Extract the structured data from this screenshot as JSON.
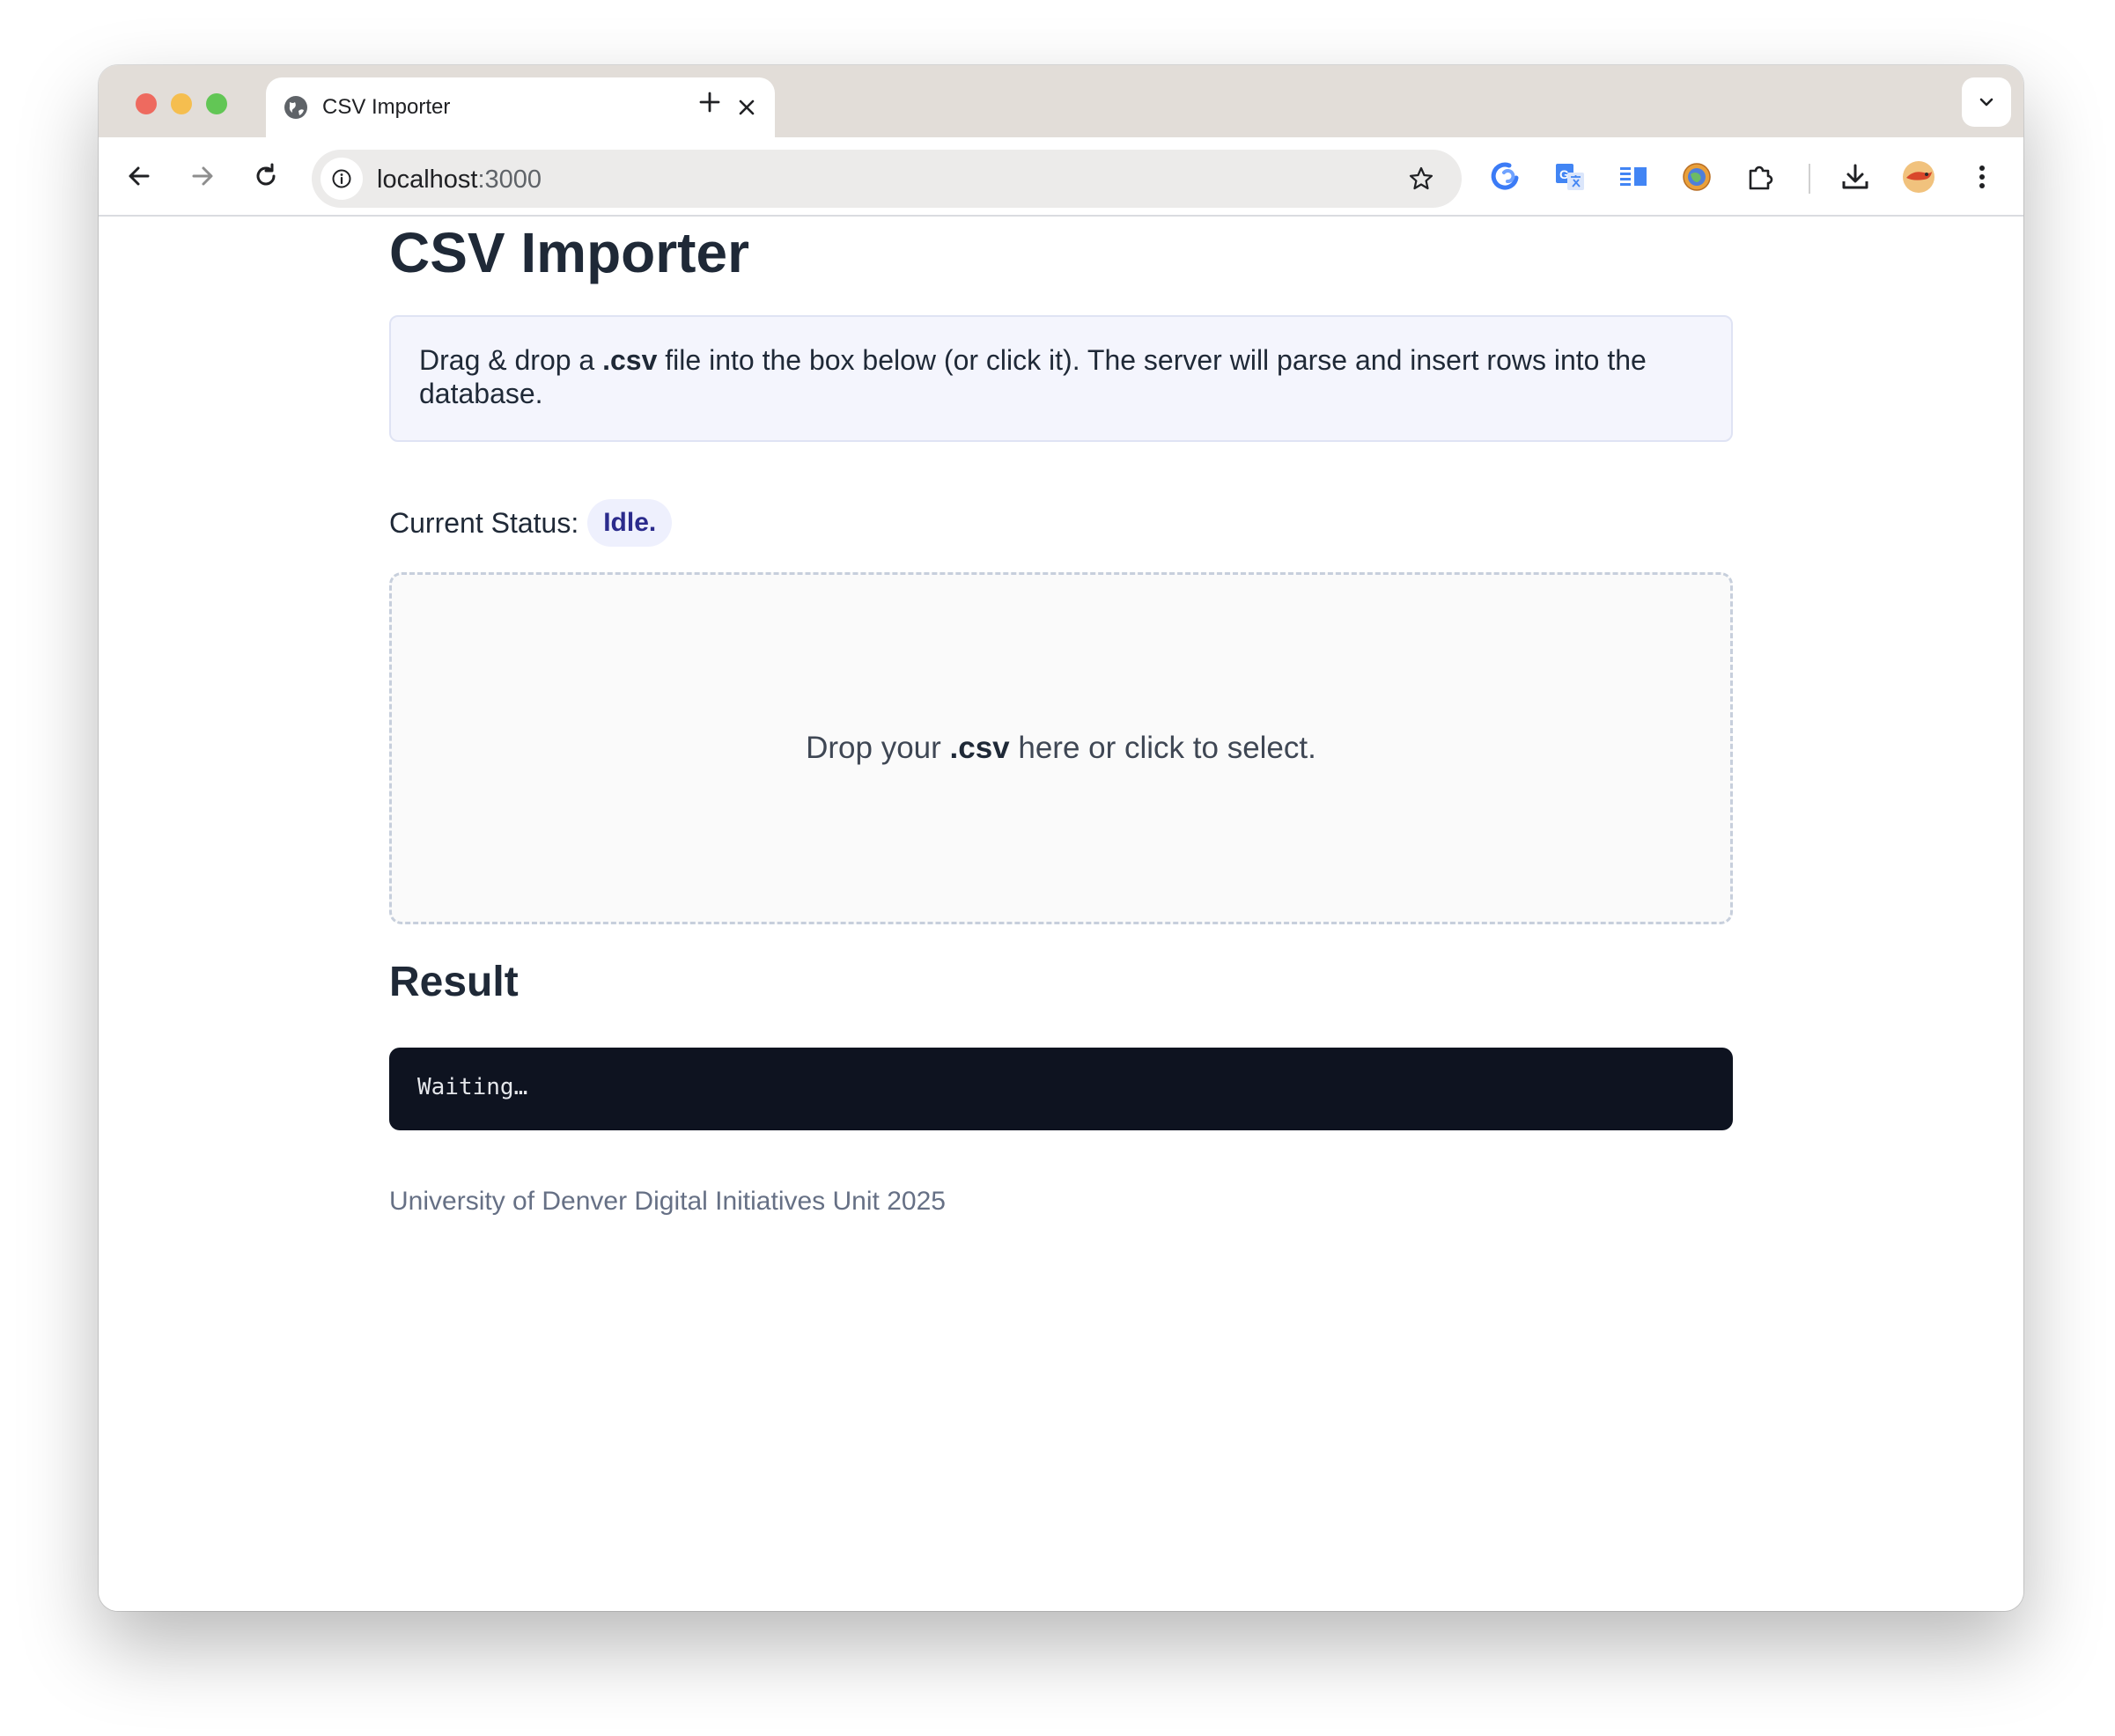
{
  "browser": {
    "tab_title": "CSV Importer",
    "url_host": "localhost",
    "url_port": ":3000",
    "extensions": [
      "sync-icon",
      "translate-icon",
      "reader-icon",
      "globe-extension-icon",
      "puzzle-icon"
    ],
    "toolbar_icons": [
      "download-icon",
      "profile-avatar",
      "more-menu-icon"
    ]
  },
  "page": {
    "title": "CSV Importer",
    "info": {
      "prefix": "Drag & drop a ",
      "emphasis": ".csv",
      "suffix": " file into the box below (or click it). The server will parse and insert rows into the database."
    },
    "status_label": "Current Status:",
    "status_value": "Idle.",
    "dropzone": {
      "prefix": "Drop your ",
      "emphasis": ".csv",
      "suffix": " here or click to select."
    },
    "result_heading": "Result",
    "result_text": "Waiting…",
    "footer": "University of Denver Digital Initiatives Unit 2025"
  },
  "colors": {
    "accent_badge_text": "#2b2b8c",
    "result_bg": "#0e1320",
    "info_bg": "#f4f5fd"
  }
}
